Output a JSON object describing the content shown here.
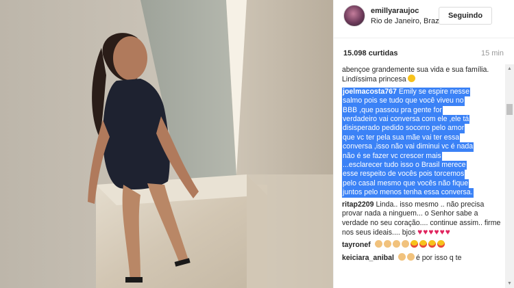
{
  "post": {
    "username": "emillyaraujoc",
    "location": "Rio de Janeiro, Brazil",
    "follow_label": "Seguindo",
    "likes": "15.098 curtidas",
    "time": "15 min"
  },
  "comments": {
    "c0_text": "abençoe grandemente sua vida e sua família. Lindíssima princesa",
    "c1_user": "joelmacosta767",
    "c1_lines": [
      "Emily se espire nesse",
      "salmo pois se tudo que você viveu no",
      "BBB ,que passou pra gente for",
      "verdadeiro vai conversa com ele ,ele tá",
      "disisperado pedido socorro pelo amor",
      "que vc ter pela sua mãe vai ter essa",
      "conversa ,isso não vai diminui vc é nada",
      "não é se fazer vc crescer mais",
      "...esclarecer tudo isso o Brasil merece",
      "esse respeito de vocês pois torcemos",
      "pelo casal mesmo que vocês não fique",
      "juntos pelo menos tenha essa conversa."
    ],
    "c2_user": "ritap2209",
    "c2_text": "Linda.. isso mesmo .. não precisa provar nada a ninguem... o Senhor sabe a verdade no seu coração.... continue assim.. firme nos seus ideais.... bjos",
    "c2_hearts": "♥♥♥♥♥♥",
    "c3_user": "tayronef",
    "c4_user": "keiciara_anibal",
    "c4_text": "é por isso q te"
  },
  "icons": {
    "scroll_up": "scroll-up-arrow",
    "scroll_down": "scroll-down-arrow"
  }
}
